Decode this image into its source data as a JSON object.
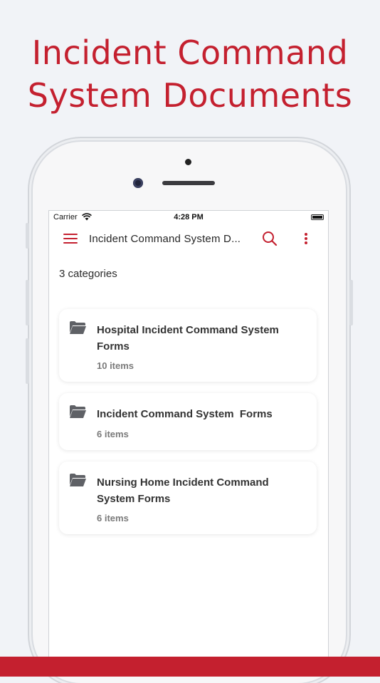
{
  "headline": {
    "line1": "Incident Command",
    "line2": "System Documents"
  },
  "status_bar": {
    "carrier": "Carrier",
    "time": "4:28 PM"
  },
  "app_bar": {
    "title": "Incident Command System D..."
  },
  "categories_count": "3 categories",
  "categories": [
    {
      "name": "Hospital Incident Command System Forms",
      "items": "10 items"
    },
    {
      "name": "Incident Command System  Forms",
      "items": "6 items"
    },
    {
      "name": "Nursing Home Incident Command System Forms",
      "items": "6 items"
    }
  ],
  "colors": {
    "accent": "#c4202f",
    "background": "#f1f3f7",
    "folder": "#5f6166"
  },
  "icons": [
    "menu-icon",
    "search-icon",
    "more-vert-icon",
    "folder-icon",
    "wifi-icon",
    "battery-icon"
  ]
}
